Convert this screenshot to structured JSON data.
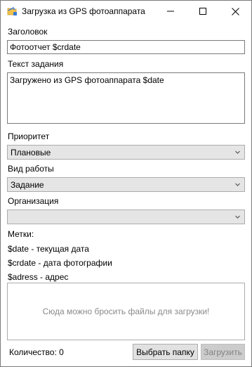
{
  "window": {
    "title": "Загрузка из GPS фотоаппарата"
  },
  "form": {
    "title_label": "Заголовок",
    "title_value": "Фотоотчет $crdate",
    "task_text_label": "Текст задания",
    "task_text_value": "Загружено из GPS фотоаппарата $date",
    "priority_label": "Приоритет",
    "priority_value": "Плановые",
    "work_type_label": "Вид работы",
    "work_type_value": "Задание",
    "organization_label": "Организация",
    "organization_value": ""
  },
  "tags": {
    "header": "Метки:",
    "items": [
      "$date - текущая дата",
      "$crdate - дата фотографии",
      "$adress - адрес"
    ]
  },
  "dropzone": {
    "hint": "Сюда можно бросить файлы для загрузки!"
  },
  "footer": {
    "count_label": "Количество: 0",
    "choose_folder_label": "Выбрать папку",
    "upload_label": "Загрузить"
  },
  "icons": {
    "app": "folder-photo-icon",
    "minimize": "minimize-icon",
    "maximize": "maximize-icon",
    "close": "close-icon",
    "dropdown": "chevron-down-icon"
  }
}
